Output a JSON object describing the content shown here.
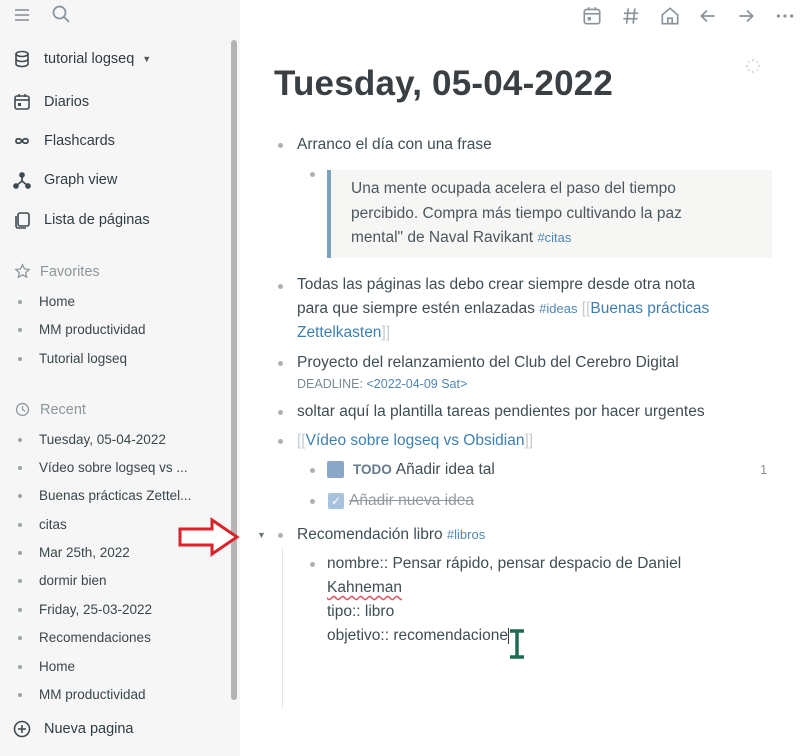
{
  "sidebar": {
    "graph_name": "tutorial logseq",
    "nav": [
      {
        "label": "Diarios",
        "icon": "calendar-icon"
      },
      {
        "label": "Flashcards",
        "icon": "infinity-icon"
      },
      {
        "label": "Graph view",
        "icon": "graph-icon"
      },
      {
        "label": "Lista de páginas",
        "icon": "pages-icon"
      }
    ],
    "favorites_title": "Favorites",
    "favorites": [
      "Home",
      "MM productividad",
      "Tutorial logseq"
    ],
    "recent_title": "Recent",
    "recent": [
      "Tuesday, 05-04-2022",
      "Vídeo sobre logseq vs ...",
      "Buenas prácticas Zettel...",
      "citas",
      "Mar 25th, 2022",
      "dormir bien",
      "Friday, 25-03-2022",
      "Recomendaciones",
      "Home",
      "MM productividad"
    ],
    "new_page": "Nueva pagina"
  },
  "page": {
    "title": "Tuesday, 05-04-2022",
    "b1": "Arranco el día con una frase",
    "quote_line1": "Una mente ocupada acelera el paso del tiempo",
    "quote_line2": "percibido. Compra más tiempo cultivando la paz",
    "quote_line3": "mental\" de Naval Ravikant",
    "quote_tag": "#citas",
    "b2_line1": "Todas las páginas las debo crear siempre desde otra nota",
    "b2_line2": "para que siempre estén enlazadas",
    "b2_tag": "#ideas",
    "b2_bracket_open": "[[",
    "b2_ref_part1": "Buenas prácticas",
    "b2_ref_part2": "Zettelkasten",
    "b2_bracket_close": "]]",
    "b3": "Proyecto del relanzamiento del Club del Cerebro Digital",
    "b3_deadline_label": "DEADLINE:",
    "b3_deadline_date": "<2022-04-09 Sat>",
    "b4": "soltar aquí la plantilla tareas pendientes por hacer urgentes",
    "b5_bracket_open": "[[",
    "b5_ref": "Vídeo sobre logseq vs Obsidian",
    "b5_bracket_close": "]]",
    "todo_keyword": "TODO",
    "todo_text": "Añadir idea tal",
    "todo_count": "1",
    "done_text": "Añadir nueva idea",
    "b6": "Recomendación libro",
    "b6_tag": "#libros",
    "prop_line1": "nombre:: Pensar rápido, pensar despacio de Daniel",
    "prop_line2": "Kahneman",
    "prop_line3": "tipo:: libro",
    "prop_line4": "objetivo:: recomendacio",
    "prop_line4_rest": "ne"
  }
}
